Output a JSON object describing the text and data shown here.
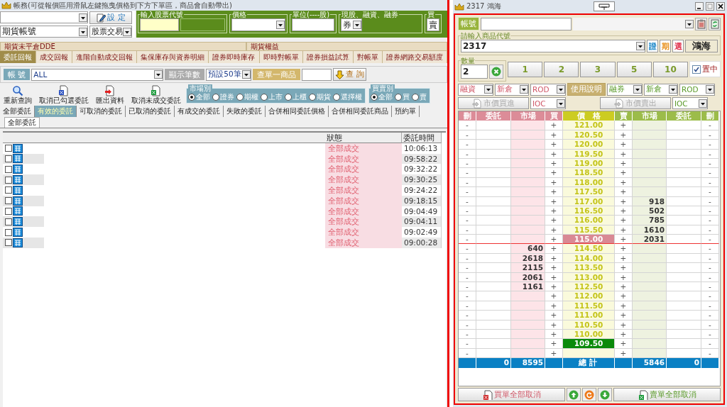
{
  "window": {
    "title": "帳務(可從報價區用滑鼠左鍵拖曳價格到下方下單區，商品會自動帶出)"
  },
  "order_entry": {
    "account_type": "期貨帳號",
    "set_button": "設 定",
    "trade_type": "股票交易",
    "code_label": "輸入股票代號",
    "price_label": "價格",
    "unit_label": "單位(----股)",
    "margin_label": "現股、融資、融券",
    "margin_value": "券",
    "side_label": "買",
    "side_value": "賣"
  },
  "panel_tabs": [
    {
      "label": "期貨未平倉DDE",
      "selected": false
    },
    {
      "label": "期貨權益",
      "selected": false
    }
  ],
  "tabs": [
    {
      "label": "委託回報",
      "selected": true
    },
    {
      "label": "成交回報",
      "selected": false
    },
    {
      "label": "進階自動成交回報",
      "selected": false
    },
    {
      "label": "集保庫存與資券明細",
      "selected": false
    },
    {
      "label": "證券即時庫存",
      "selected": false
    },
    {
      "label": "即時對帳單",
      "selected": false
    },
    {
      "label": "證券損益試算",
      "selected": false
    },
    {
      "label": "對帳單",
      "selected": false
    },
    {
      "label": "證券網路交易額度",
      "selected": false
    }
  ],
  "filter": {
    "account_label": "帳 號",
    "account": "ALL",
    "count_label": "顯示筆數",
    "count": "預設50筆",
    "product_label": "查單一商品",
    "query_button": "查 詢"
  },
  "toolbar": [
    {
      "label": "重新查詢",
      "kind": "search"
    },
    {
      "label": "取消已勾選委託",
      "kind": "cancel"
    },
    {
      "label": "匯出資料",
      "kind": "export"
    },
    {
      "label": "取消未成交委託",
      "kind": "sheet"
    }
  ],
  "market_filter": {
    "label": "市場別",
    "options": [
      {
        "label": "全部",
        "selected": true
      },
      {
        "label": "證券",
        "selected": false
      },
      {
        "label": "期權",
        "selected": false
      },
      {
        "label": "上市",
        "selected": false
      },
      {
        "label": "上櫃",
        "selected": false
      },
      {
        "label": "期貨",
        "selected": false
      },
      {
        "label": "選擇權",
        "selected": false
      }
    ]
  },
  "side_filter": {
    "label": "買賣別",
    "options": [
      {
        "label": "全部",
        "selected": true
      },
      {
        "label": "買",
        "selected": false
      },
      {
        "label": "賣",
        "selected": false
      }
    ]
  },
  "order_tabs": [
    {
      "label": "全部委託",
      "selected": false
    },
    {
      "label": "有效的委託",
      "selected": true
    },
    {
      "label": "可取消的委託",
      "selected": false
    },
    {
      "label": "已取消的委託",
      "selected": false
    },
    {
      "label": "有成交的委託",
      "selected": false
    },
    {
      "label": "失敗的委託",
      "selected": false
    },
    {
      "label": "合併相同委託價格",
      "selected": false
    },
    {
      "label": "合併相同委託商品",
      "selected": false
    },
    {
      "label": "預約單",
      "selected": false
    }
  ],
  "sub_tabs": [
    {
      "label": "全部委託",
      "selected": true
    }
  ],
  "orders": {
    "columns": [
      "狀態",
      "委託時間"
    ],
    "rows": [
      {
        "checked": false,
        "status": "全部成交",
        "time": "10:06:13"
      },
      {
        "checked": false,
        "status": "全部成交",
        "time": "09:58:22"
      },
      {
        "checked": false,
        "status": "全部成交",
        "time": "09:32:22"
      },
      {
        "checked": false,
        "status": "全部成交",
        "time": "09:30:25"
      },
      {
        "checked": false,
        "status": "全部成交",
        "time": "09:24:22"
      },
      {
        "checked": false,
        "status": "全部成交",
        "time": "09:18:15"
      },
      {
        "checked": false,
        "status": "全部成交",
        "time": "09:04:49"
      },
      {
        "checked": false,
        "status": "全部成交",
        "time": "09:04:11"
      },
      {
        "checked": false,
        "status": "全部成交",
        "time": "09:02:49"
      },
      {
        "checked": false,
        "status": "全部成交",
        "time": "09:00:28"
      }
    ]
  },
  "quote_window": {
    "title": "2317 鴻海",
    "account_label": "帳號",
    "code_label": "請輸入商品代號",
    "code": "2317",
    "market_buttons": [
      {
        "label": "證",
        "color": "#1a86c8"
      },
      {
        "label": "期",
        "color": "#e8901c"
      },
      {
        "label": "選",
        "color": "#e0304a"
      }
    ],
    "product_name": "鴻海",
    "quantity_label": "數量",
    "quantity": "2",
    "quick_quantities": [
      "1",
      "2",
      "3",
      "5",
      "10"
    ],
    "center": {
      "label": "置中",
      "checked": true
    },
    "buy_options": [
      "融資",
      "新倉",
      "ROD"
    ],
    "help_button": "使用說明",
    "sell_options": [
      "融券",
      "新倉",
      "ROD"
    ],
    "market_buy": {
      "label": "市價買進",
      "disabled": true
    },
    "buy_tif": "IOC",
    "market_sell": {
      "label": "市價賣出",
      "disabled": true
    },
    "sell_tif": "IOC",
    "ladder": {
      "columns": [
        "刪",
        "委託",
        "市場",
        "買",
        "價　格",
        "賣",
        "市場",
        "委託",
        "刪"
      ],
      "rows": [
        {
          "del_buy": "-",
          "buy": "+",
          "price": "121.00",
          "sell": "+",
          "del_sell": "-"
        },
        {
          "del_buy": "-",
          "buy": "+",
          "price": "120.50",
          "sell": "+",
          "del_sell": "-"
        },
        {
          "del_buy": "-",
          "buy": "+",
          "price": "120.00",
          "sell": "+",
          "del_sell": "-"
        },
        {
          "del_buy": "-",
          "buy": "+",
          "price": "119.50",
          "sell": "+",
          "del_sell": "-"
        },
        {
          "del_buy": "-",
          "buy": "+",
          "price": "119.00",
          "sell": "+",
          "del_sell": "-"
        },
        {
          "del_buy": "-",
          "buy": "+",
          "price": "118.50",
          "sell": "+",
          "del_sell": "-"
        },
        {
          "del_buy": "-",
          "buy": "+",
          "price": "118.00",
          "sell": "+",
          "del_sell": "-"
        },
        {
          "del_buy": "-",
          "buy": "+",
          "price": "117.50",
          "sell": "+",
          "del_sell": "-"
        },
        {
          "del_buy": "-",
          "buy": "+",
          "price": "117.00",
          "sell": "+",
          "sell_market": "918",
          "del_sell": "-"
        },
        {
          "del_buy": "-",
          "buy": "+",
          "price": "116.50",
          "sell": "+",
          "sell_market": "502",
          "del_sell": "-"
        },
        {
          "del_buy": "-",
          "buy": "+",
          "price": "116.00",
          "sell": "+",
          "sell_market": "785",
          "del_sell": "-"
        },
        {
          "del_buy": "-",
          "buy": "+",
          "price": "115.50",
          "sell": "+",
          "sell_market": "1610",
          "del_sell": "-"
        },
        {
          "del_buy": "-",
          "buy": "+",
          "price": "115.00",
          "color": "#d98994",
          "split": true,
          "sell": "+",
          "sell_market": "2031",
          "del_sell": "-"
        },
        {
          "del_buy": "-",
          "buy_market": "640",
          "buy": "+",
          "price": "114.50",
          "sell": "+",
          "del_sell": "-"
        },
        {
          "del_buy": "-",
          "buy_market": "2618",
          "buy": "+",
          "price": "114.00",
          "sell": "+",
          "del_sell": "-"
        },
        {
          "del_buy": "-",
          "buy_market": "2115",
          "buy": "+",
          "price": "113.50",
          "sell": "+",
          "del_sell": "-"
        },
        {
          "del_buy": "-",
          "buy_market": "2061",
          "buy": "+",
          "price": "113.00",
          "sell": "+",
          "del_sell": "-"
        },
        {
          "del_buy": "-",
          "buy_market": "1161",
          "buy": "+",
          "price": "112.50",
          "sell": "+",
          "del_sell": "-"
        },
        {
          "del_buy": "-",
          "buy": "+",
          "price": "112.00",
          "sell": "+",
          "del_sell": "-"
        },
        {
          "del_buy": "-",
          "buy": "+",
          "price": "111.50",
          "sell": "+",
          "del_sell": "-"
        },
        {
          "del_buy": "-",
          "buy": "+",
          "price": "111.00",
          "sell": "+",
          "del_sell": "-"
        },
        {
          "del_buy": "-",
          "buy": "+",
          "price": "110.50",
          "sell": "+",
          "del_sell": "-"
        },
        {
          "del_buy": "-",
          "buy": "+",
          "price": "110.00",
          "sell": "+",
          "del_sell": "-"
        },
        {
          "del_buy": "-",
          "buy": "+",
          "price": "109.50",
          "color": "#0a8a0a",
          "sell": "+",
          "del_sell": "-"
        },
        {
          "del_buy": "-",
          "buy": "+",
          "sell": "+",
          "del_sell": "-"
        }
      ],
      "total": {
        "buy_orders": "0",
        "buy_market": "8595",
        "label": "總 計",
        "sell_market": "5846",
        "sell_orders": "0"
      }
    },
    "cancel_buys": "買單全部取消",
    "cancel_sells": "賣單全部取消"
  }
}
